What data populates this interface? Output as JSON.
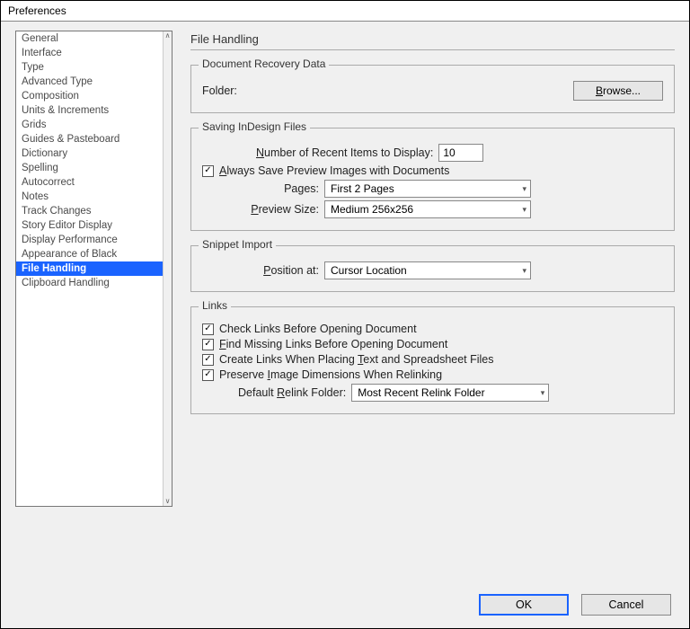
{
  "window": {
    "title": "Preferences"
  },
  "sidebar": {
    "items": [
      "General",
      "Interface",
      "Type",
      "Advanced Type",
      "Composition",
      "Units & Increments",
      "Grids",
      "Guides & Pasteboard",
      "Dictionary",
      "Spelling",
      "Autocorrect",
      "Notes",
      "Track Changes",
      "Story Editor Display",
      "Display Performance",
      "Appearance of Black",
      "File Handling",
      "Clipboard Handling"
    ],
    "selected_index": 16
  },
  "page": {
    "title": "File Handling",
    "recovery": {
      "group_title": "Document Recovery Data",
      "folder_label": "Folder:",
      "browse_label": "Browse..."
    },
    "saving": {
      "group_title": "Saving InDesign Files",
      "recent_label_pre": "N",
      "recent_label_post": "umber of Recent Items to Display:",
      "recent_value": "10",
      "always_save_pre": "A",
      "always_save_post": "lways Save Preview Images with Documents",
      "always_save_checked": true,
      "pages_label": "Pages:",
      "pages_value": "First 2 Pages",
      "preview_label_pre": "P",
      "preview_label_post": "review Size:",
      "preview_value": "Medium 256x256"
    },
    "snippet": {
      "group_title": "Snippet Import",
      "position_label_pre": "P",
      "position_label_post": "osition at:",
      "position_value": "Cursor Location"
    },
    "links": {
      "group_title": "Links",
      "check_links": {
        "checked": true,
        "text": "Check Links Before Opening Document"
      },
      "find_missing_pre": "F",
      "find_missing_post": "ind Missing Links Before Opening Document",
      "find_missing_checked": true,
      "create_links_pre": "Create Links When Placing ",
      "create_links_u": "T",
      "create_links_post": "ext and Spreadsheet Files",
      "create_links_checked": true,
      "preserve_pre": "Preserve ",
      "preserve_u": "I",
      "preserve_post": "mage Dimensions When Relinking",
      "preserve_checked": true,
      "relink_label_pre": "Default ",
      "relink_label_u": "R",
      "relink_label_post": "elink Folder:",
      "relink_value": "Most Recent Relink Folder"
    }
  },
  "footer": {
    "ok": "OK",
    "cancel": "Cancel"
  }
}
